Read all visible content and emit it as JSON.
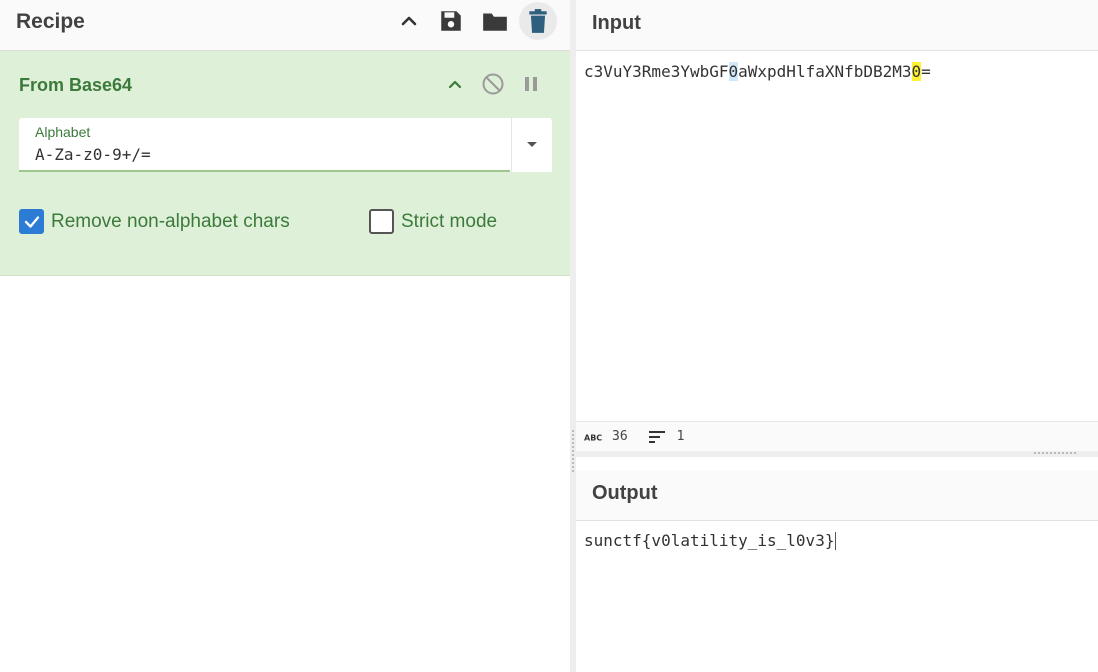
{
  "recipe": {
    "title": "Recipe",
    "toolbar": {
      "collapse_icon": "chevron-up-icon",
      "save_icon": "save-icon",
      "load_icon": "folder-icon",
      "clear_icon": "trash-icon"
    },
    "operation": {
      "title": "From Base64",
      "alphabet_label": "Alphabet",
      "alphabet_value": "A-Za-z0-9+/=",
      "remove_nonalpha_label": "Remove non-alphabet chars",
      "remove_nonalpha_checked": true,
      "strict_mode_label": "Strict mode",
      "strict_mode_checked": false
    }
  },
  "input": {
    "title": "Input",
    "text_a": "c3VuY3Rme3YwbGF",
    "text_hl1": "0",
    "text_b": "aWxpdHlfaXNfbDB2M3",
    "text_hl2": "0",
    "text_c": "=",
    "char_count": "36",
    "line_count": "1"
  },
  "output": {
    "title": "Output",
    "text": "sunctf{v0latility_is_l0v3}"
  },
  "colors": {
    "accent_green": "#3c7a3c",
    "op_background": "#dff0d8",
    "checkbox_blue": "#2c7cd6",
    "highlight_yellow": "#fff233",
    "highlight_blue": "#cfe9fb"
  }
}
